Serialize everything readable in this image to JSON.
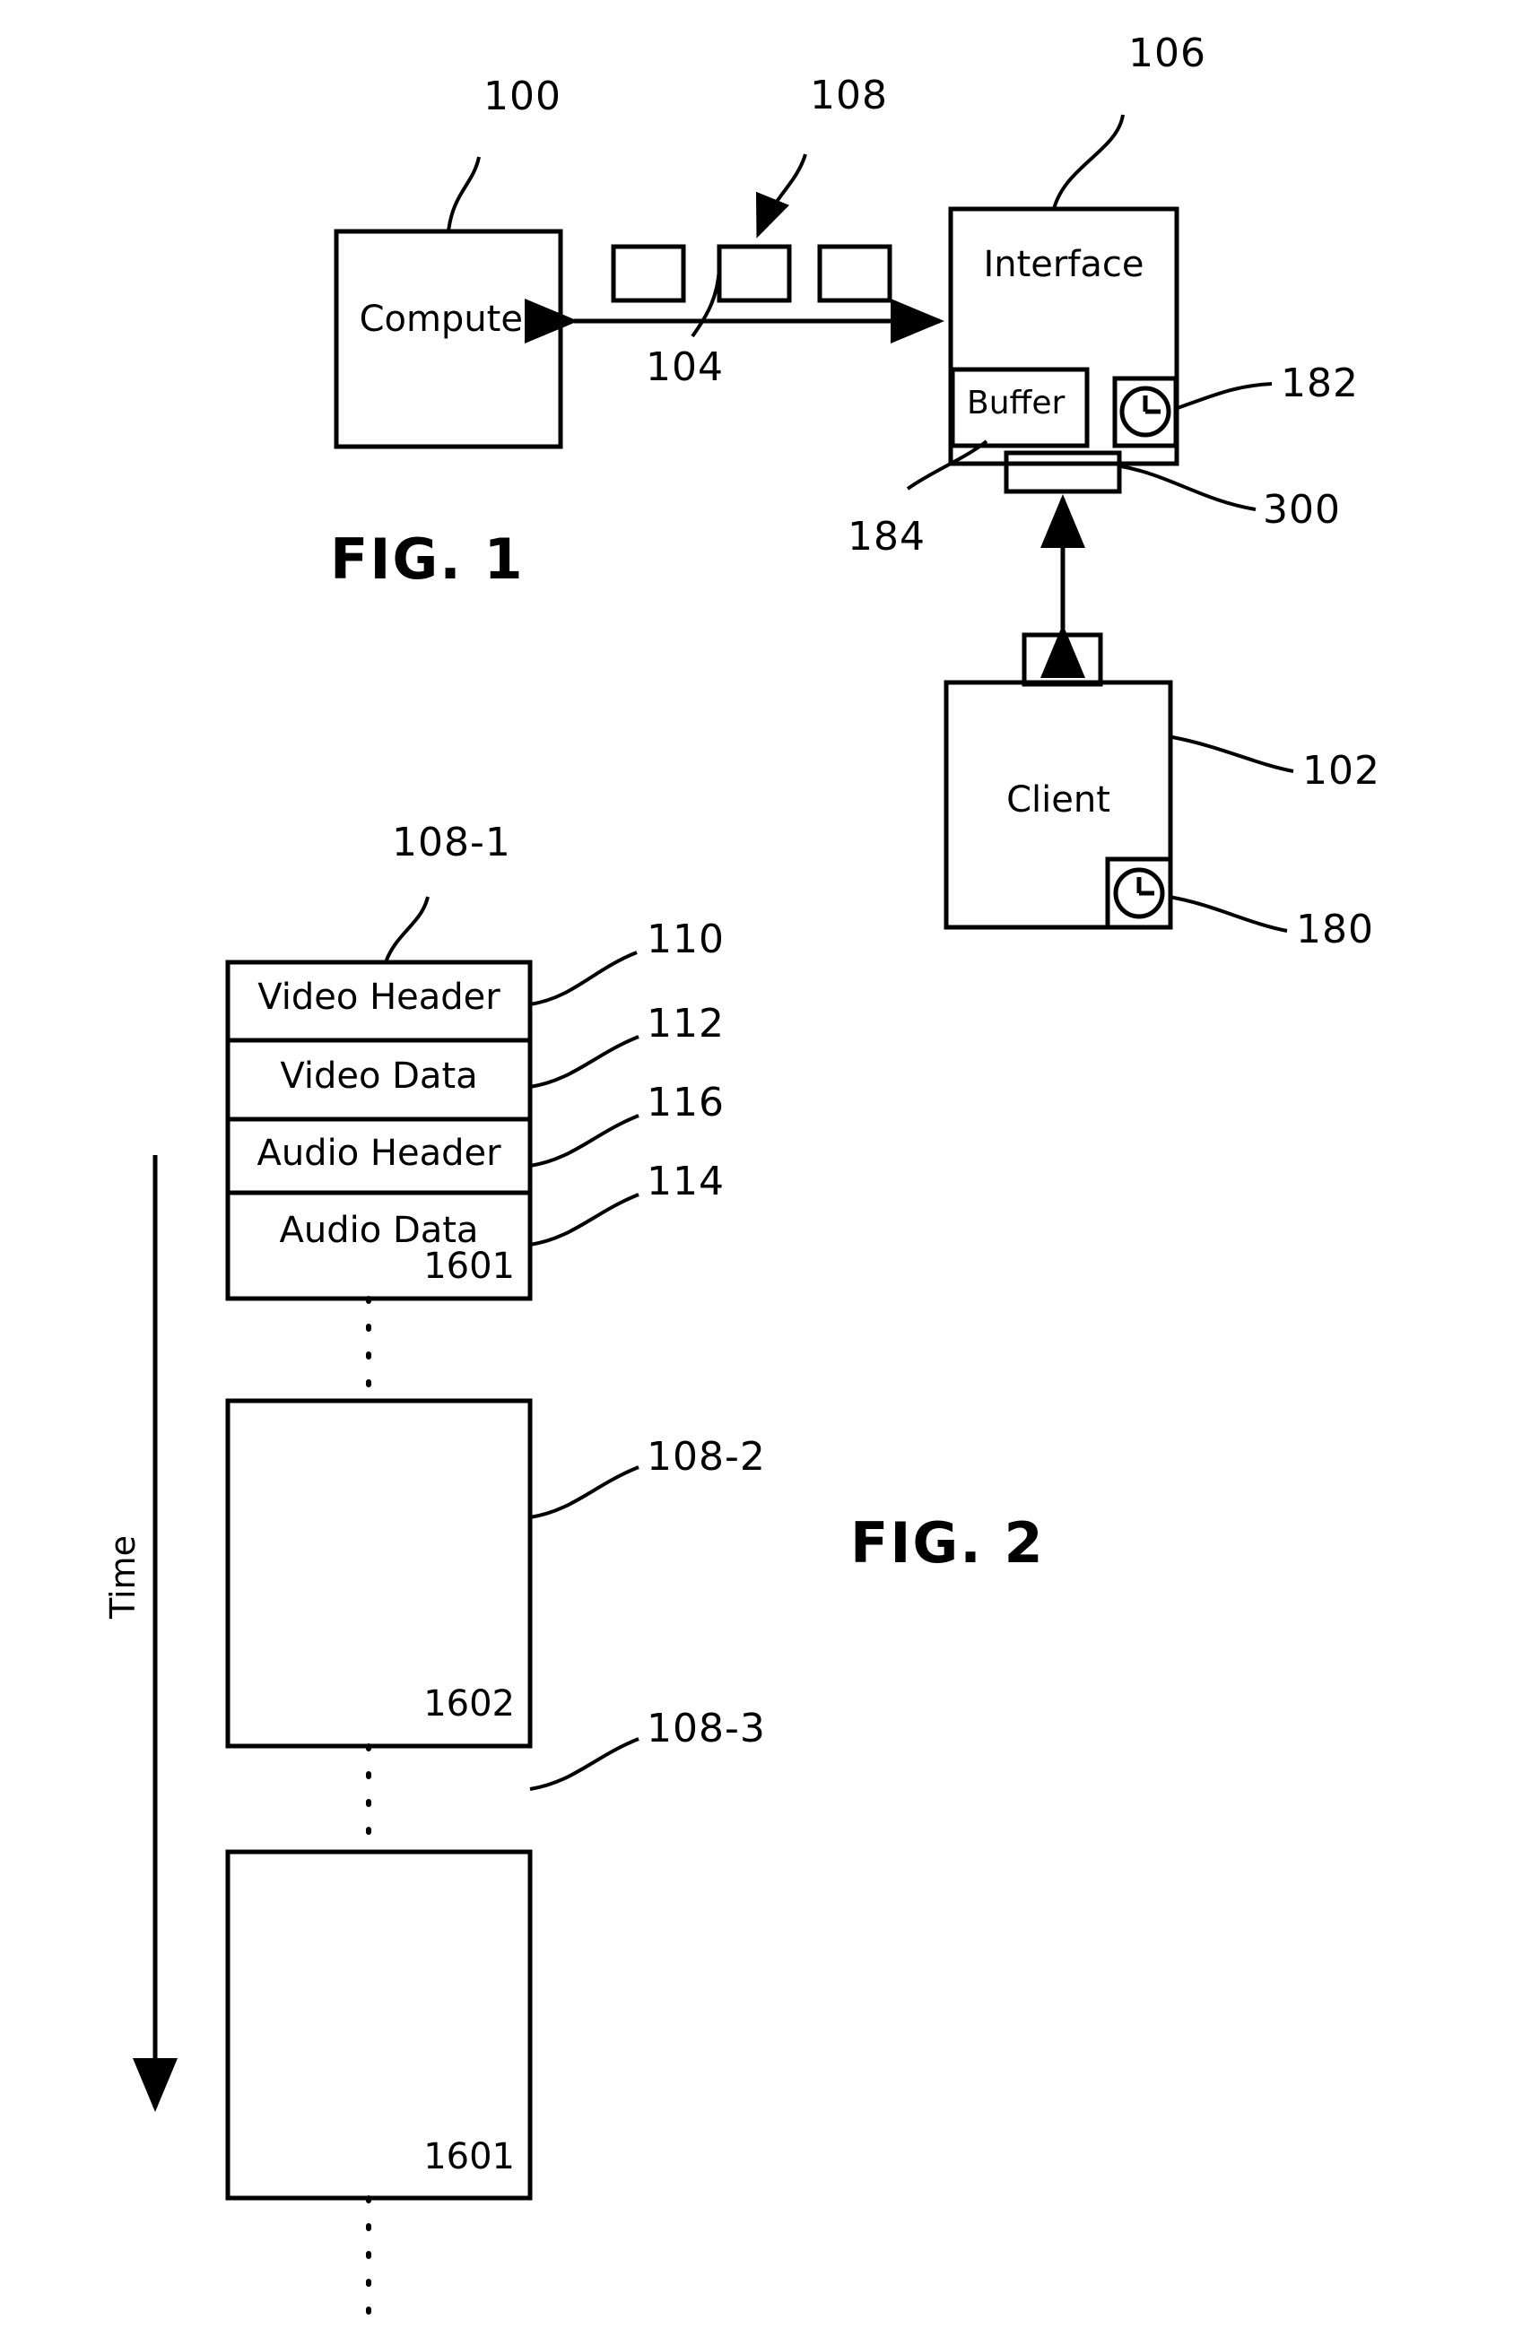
{
  "figures": [
    {
      "caption": "FIG. 1",
      "nodes": {
        "computer": {
          "label": "Computer",
          "ref": "100"
        },
        "interface": {
          "label": "Interface",
          "ref": "106"
        },
        "buffer": {
          "label": "Buffer",
          "ref": "184"
        },
        "client": {
          "label": "Client",
          "ref": "102"
        },
        "packets": {
          "ref": "108"
        },
        "link": {
          "ref": "104"
        },
        "interface_clock": {
          "ref": "182",
          "icon": "clock-icon"
        },
        "client_clock": {
          "ref": "180",
          "icon": "clock-icon"
        },
        "transceiver": {
          "ref": "300"
        }
      }
    },
    {
      "caption": "FIG. 2",
      "axis": {
        "label": "Time",
        "direction": "down"
      },
      "packets": [
        {
          "ref": "108-1",
          "stamp": "1601",
          "fields": [
            {
              "label": "Video Header",
              "ref": "110"
            },
            {
              "label": "Video Data",
              "ref": "112"
            },
            {
              "label": "Audio Header",
              "ref": "116"
            },
            {
              "label": "Audio Data",
              "ref": "114"
            }
          ]
        },
        {
          "ref": "108-2",
          "stamp": "1602",
          "fields": []
        },
        {
          "ref": "108-3",
          "stamp": "1601",
          "fields": []
        }
      ]
    }
  ],
  "colors": {
    "ink": "#000000",
    "paper": "#ffffff"
  }
}
